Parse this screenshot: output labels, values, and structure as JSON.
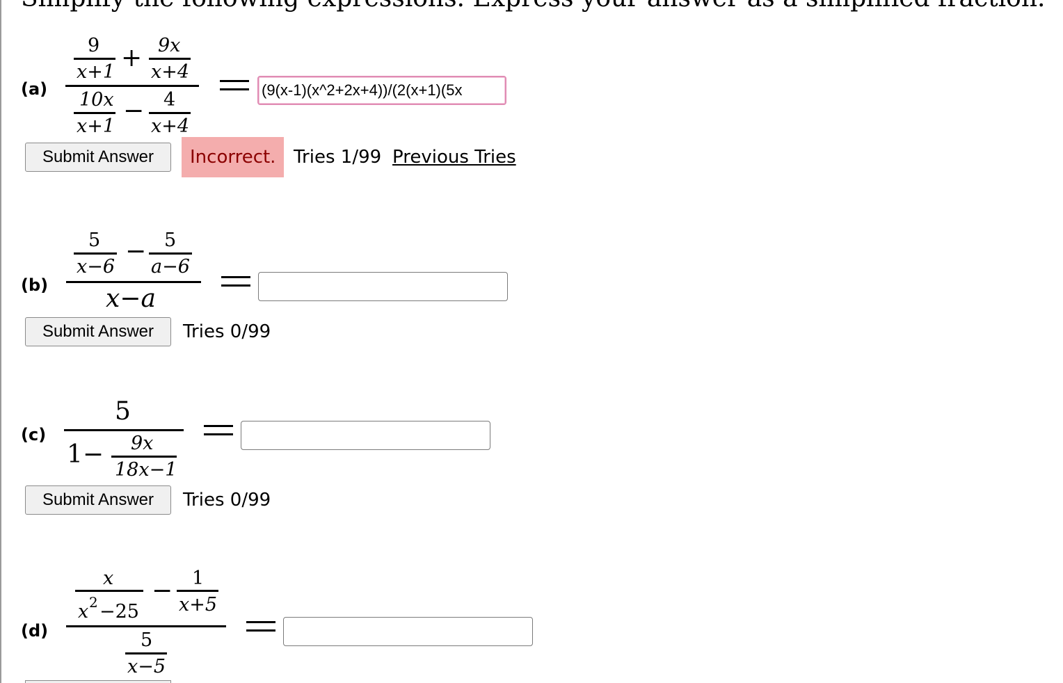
{
  "instructions": "Simplify the following expressions. Express your answer as a simplified fraction.",
  "parts": [
    {
      "label": "(a)",
      "expr": {
        "num_left_top": "9",
        "num_left_bottom": "x+1",
        "num_op": "+",
        "num_right_top": "9x",
        "num_right_bottom": "x+4",
        "den_left_top": "10x",
        "den_left_bottom": "x+1",
        "den_op": "−",
        "den_right_top": "4",
        "den_right_bottom": "x+4"
      },
      "answer_value": "(9(x-1)(x^2+2x+4))/(2(x+1)(5x",
      "submit_label": "Submit Answer",
      "status": "Incorrect.",
      "tries": "Tries 1/99",
      "previous_tries": "Previous Tries"
    },
    {
      "label": "(b)",
      "expr": {
        "num_left_top": "5",
        "num_left_bottom": "x−6",
        "num_op": "−",
        "num_right_top": "5",
        "num_right_bottom": "a−6",
        "den": "x−a"
      },
      "answer_value": "",
      "submit_label": "Submit Answer",
      "tries": "Tries 0/99"
    },
    {
      "label": "(c)",
      "expr": {
        "num": "5",
        "den_lead": "1−",
        "den_frac_top": "9x",
        "den_frac_bottom": "18x−1"
      },
      "answer_value": "",
      "submit_label": "Submit Answer",
      "tries": "Tries 0/99"
    },
    {
      "label": "(d)",
      "expr": {
        "num_left_top": "x",
        "num_left_bottom_base": "x",
        "num_left_bottom_exp": "2",
        "num_left_bottom_rest": "−25",
        "num_op": "−",
        "num_right_top": "1",
        "num_right_bottom": "x+5",
        "den_top": "5",
        "den_bottom": "x−5"
      },
      "answer_value": ""
    }
  ]
}
